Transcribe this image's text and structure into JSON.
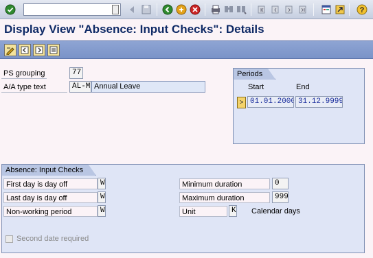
{
  "toolbar": {
    "command_field_value": "",
    "icons": [
      "enter-icon",
      "command-dropdown-icon",
      "back-arrow-icon",
      "save-icon",
      "back-icon",
      "exit-icon",
      "cancel-icon",
      "print-icon",
      "find-icon",
      "find-next-icon",
      "first-page-icon",
      "previous-page-icon",
      "next-page-icon",
      "last-page-icon",
      "new-session-icon",
      "shortcut-icon",
      "help-icon"
    ]
  },
  "page": {
    "title": "Display View \"Absence: Input Checks\": Details"
  },
  "app_toolbar": {
    "icons": [
      "display-change-icon",
      "previous-entry-icon",
      "next-entry-icon",
      "variable-list-icon"
    ]
  },
  "header_fields": {
    "ps_grouping_label": "PS grouping",
    "ps_grouping_value": "77",
    "aa_type_label": "A/A type text",
    "aa_type_code": "AL-M",
    "aa_type_text": "Annual Leave"
  },
  "periods": {
    "title": "Periods",
    "start_header": "Start",
    "end_header": "End",
    "row_selector": ">",
    "start_value": "01.01.2000",
    "end_value": "31.12.9999"
  },
  "checks": {
    "title": "Absence: Input Checks",
    "first_day_label": "First day is day off",
    "first_day_value": "W",
    "last_day_label": "Last day is day off",
    "last_day_value": "W",
    "nonworking_label": "Non-working period",
    "nonworking_value": "W",
    "min_duration_label": "Minimum duration",
    "min_duration_value": "0",
    "max_duration_label": "Maximum duration",
    "max_duration_value": "999",
    "unit_label": "Unit",
    "unit_value": "K",
    "unit_text": "Calendar days",
    "second_date_label": "Second date required",
    "second_date_checked": false
  }
}
